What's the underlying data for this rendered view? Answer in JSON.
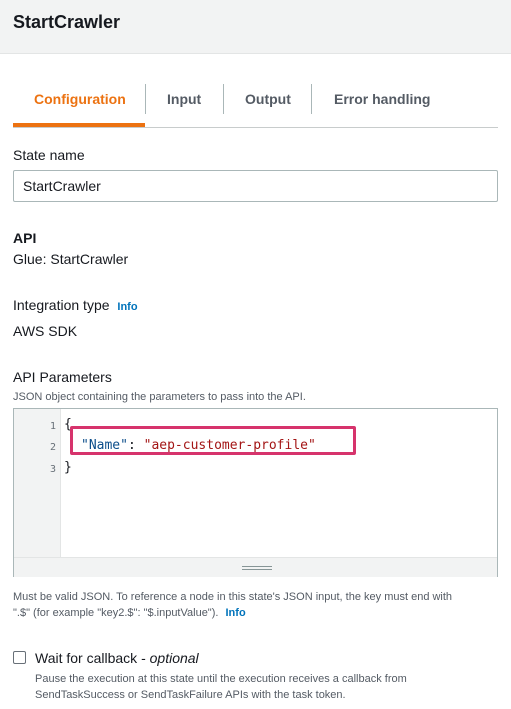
{
  "header": {
    "title": "StartCrawler"
  },
  "tabs": [
    {
      "label": "Configuration",
      "active": true
    },
    {
      "label": "Input"
    },
    {
      "label": "Output"
    },
    {
      "label": "Error handling"
    }
  ],
  "state_name": {
    "label": "State name",
    "value": "StartCrawler"
  },
  "api": {
    "label": "API",
    "value": "Glue: StartCrawler"
  },
  "integration": {
    "label": "Integration type",
    "info": "Info",
    "value": "AWS SDK"
  },
  "api_parameters": {
    "label": "API Parameters",
    "description": "JSON object containing the parameters to pass into the API.",
    "line_numbers": [
      "1",
      "2",
      "3"
    ],
    "code": {
      "open": "{",
      "key": "\"Name\"",
      "colon": ": ",
      "value": "\"aep-customer-profile\"",
      "close": "}"
    },
    "help_line1": "Must be valid JSON. To reference a node in this state's JSON input, the key must end with",
    "help_line2": "\".$\" (for example \"key2.$\": \"$.inputValue\").",
    "help_info": "Info"
  },
  "callback": {
    "label": "Wait for callback - ",
    "optional": "optional",
    "checked": false,
    "description_line1": "Pause the execution at this state until the execution receives a callback from",
    "description_line2": "SendTaskSuccess or SendTaskFailure APIs with the task token."
  },
  "colors": {
    "accent": "#ec7211",
    "link": "#0073bb",
    "highlight_border": "#d6336c"
  }
}
